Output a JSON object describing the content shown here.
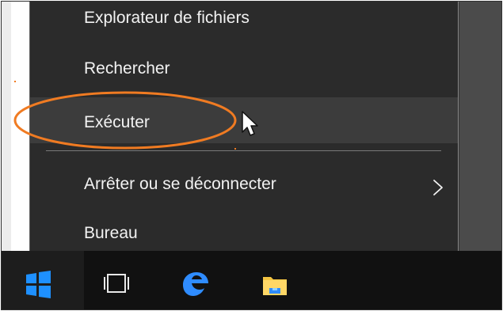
{
  "window": {
    "background": "#ffffff",
    "desktop_color": "#4b4b4b",
    "menu_color": "#2b2b2b",
    "highlight_color": "#3c3c3c",
    "accent": "#f07b22"
  },
  "menu": {
    "items": [
      {
        "label": "Explorateur de fichiers"
      },
      {
        "label": "Rechercher"
      },
      {
        "label": "Exécuter"
      },
      {
        "label": "Arrêter ou se déconnecter",
        "submenu_icon": "chevron-right-icon"
      },
      {
        "label": "Bureau"
      }
    ]
  },
  "taskbar": {
    "icons": [
      "windows-start-icon",
      "task-view-icon",
      "edge-icon",
      "file-explorer-icon"
    ]
  }
}
